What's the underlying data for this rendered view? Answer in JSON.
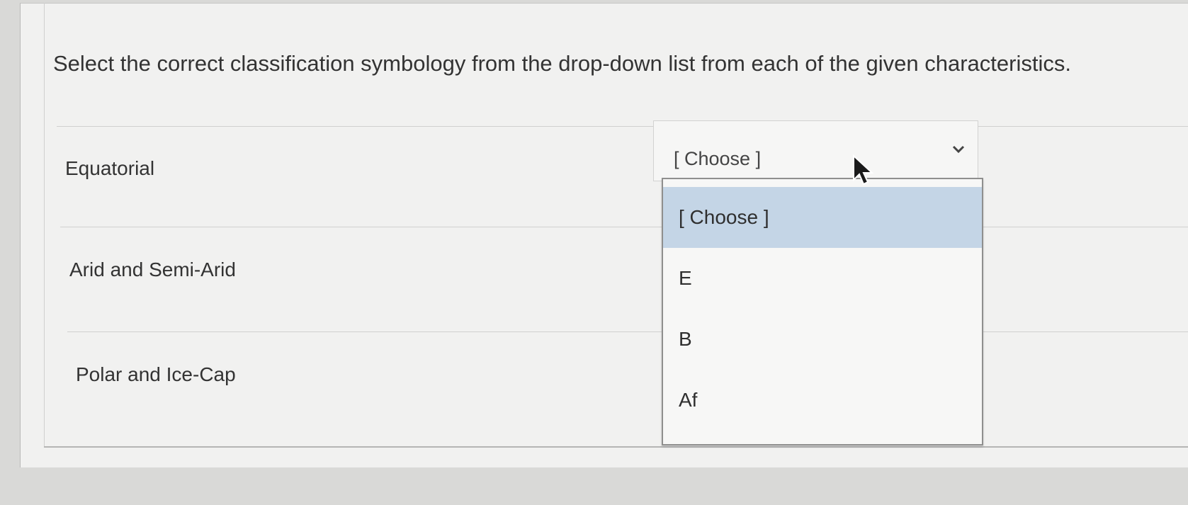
{
  "question": {
    "text": "Select the correct classification symbology from the drop-down list from each of the given characteristics."
  },
  "rows": [
    {
      "label": "Equatorial"
    },
    {
      "label": "Arid and Semi-Arid"
    },
    {
      "label": "Polar and Ice-Cap"
    }
  ],
  "select": {
    "value": "[ Choose ]",
    "icon": "chevron-down-icon"
  },
  "dropdown": {
    "options": [
      {
        "label": "[ Choose ]",
        "selected": true
      },
      {
        "label": "E"
      },
      {
        "label": "B"
      },
      {
        "label": "Af"
      }
    ]
  },
  "colors": {
    "selected_option": "#c4d5e6",
    "panel": "#f1f1f0"
  }
}
